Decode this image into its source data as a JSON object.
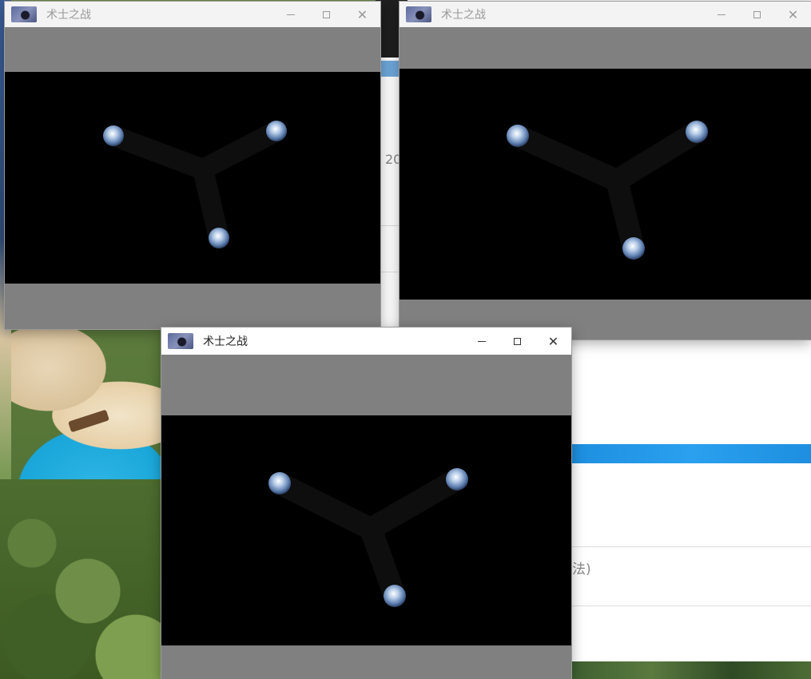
{
  "desktop": {
    "background": "beach-cliff-wallpaper"
  },
  "background_app": {
    "partial_number": "20",
    "partial_text": "法)"
  },
  "windows": [
    {
      "id": "game-window-1",
      "title": "术士之战",
      "active": false,
      "controls": {
        "minimize": "─",
        "maximize": "☐",
        "close": "✕"
      }
    },
    {
      "id": "game-window-2",
      "title": "术士之战",
      "active": false,
      "controls": {
        "minimize": "─",
        "maximize": "☐",
        "close": "✕"
      }
    },
    {
      "id": "game-window-3",
      "title": "术士之战",
      "active": true,
      "controls": {
        "minimize": "─",
        "maximize": "☐",
        "close": "✕"
      }
    }
  ],
  "game_scene": {
    "player_count": 3,
    "player_icon": "crystal-orb-icon",
    "colors": {
      "orb": "#9bb8dd",
      "trail": "#0e0e0e",
      "letterbox": "#808080",
      "field": "#000000"
    }
  }
}
